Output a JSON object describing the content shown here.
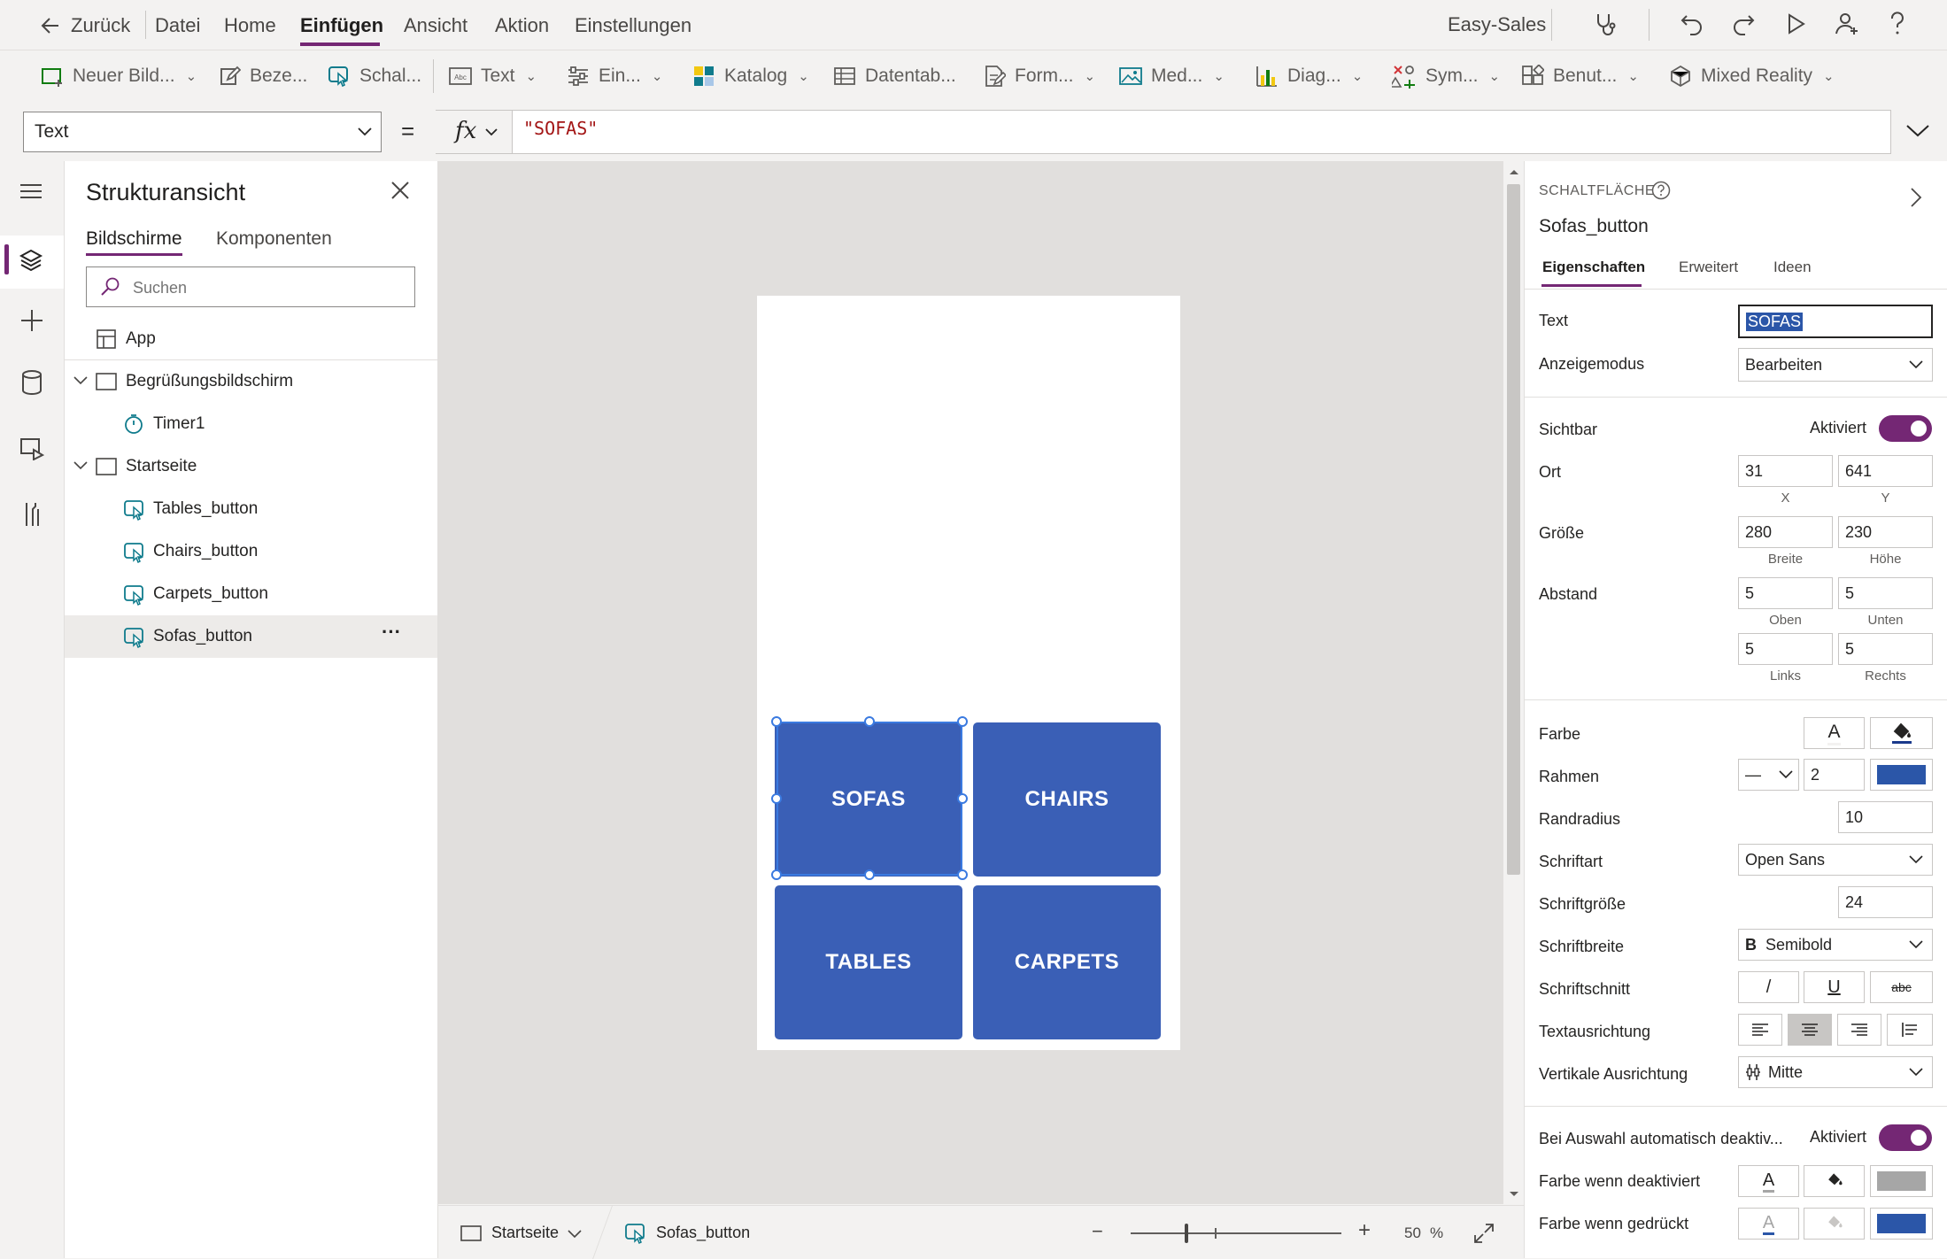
{
  "menubar": {
    "back_label": "Zurück",
    "items": [
      "Datei",
      "Home",
      "Einfügen",
      "Ansicht",
      "Aktion",
      "Einstellungen"
    ],
    "active_item": "Einfügen",
    "app_name": "Easy-Sales"
  },
  "ribbon": {
    "items": [
      {
        "label": "Neuer Bild...",
        "icon": "new-screen-icon"
      },
      {
        "label": "Beze...",
        "icon": "label-icon"
      },
      {
        "label": "Schal...",
        "icon": "button-icon"
      },
      {
        "label": "Text",
        "icon": "text-input-icon"
      },
      {
        "label": "Ein...",
        "icon": "sliders-icon"
      },
      {
        "label": "Katalog",
        "icon": "gallery-icon"
      },
      {
        "label": "Datentab...",
        "icon": "data-table-icon"
      },
      {
        "label": "Form...",
        "icon": "form-icon"
      },
      {
        "label": "Med...",
        "icon": "media-icon"
      },
      {
        "label": "Diag...",
        "icon": "chart-icon"
      },
      {
        "label": "Sym...",
        "icon": "symbols-icon"
      },
      {
        "label": "Benut...",
        "icon": "custom-icon"
      },
      {
        "label": "Mixed Reality",
        "icon": "mixed-reality-icon"
      }
    ]
  },
  "formula": {
    "property": "Text",
    "equals": "=",
    "fx": "fx",
    "value": "\"SOFAS\""
  },
  "tree": {
    "title": "Strukturansicht",
    "tabs": [
      "Bildschirme",
      "Komponenten"
    ],
    "active_tab": "Bildschirme",
    "search_placeholder": "Suchen",
    "app_label": "App",
    "screens": [
      {
        "name": "Begrüßungsbildschirm",
        "children": [
          "Timer1"
        ]
      },
      {
        "name": "Startseite",
        "children": [
          "Tables_button",
          "Chairs_button",
          "Carpets_button",
          "Sofas_button"
        ]
      }
    ],
    "selected": "Sofas_button",
    "more": "···"
  },
  "canvas": {
    "buttons": [
      "SOFAS",
      "CHAIRS",
      "TABLES",
      "CARPETS"
    ],
    "button_color": "#3a5fb6",
    "selected_button": "SOFAS"
  },
  "statusbar": {
    "screen": "Startseite",
    "control": "Sofas_button",
    "zoom_minus": "−",
    "zoom_plus": "+",
    "zoom_value": "50",
    "zoom_unit": "%"
  },
  "props": {
    "type_label": "SCHALTFLÄCHE",
    "control_name": "Sofas_button",
    "tabs": [
      "Eigenschaften",
      "Erweitert",
      "Ideen"
    ],
    "active_tab": "Eigenschaften",
    "text": {
      "label": "Text",
      "value": "SOFAS"
    },
    "display_mode": {
      "label": "Anzeigemodus",
      "value": "Bearbeiten"
    },
    "visible": {
      "label": "Sichtbar",
      "value": "Aktiviert"
    },
    "position": {
      "label": "Ort",
      "x": "31",
      "y": "641",
      "x_label": "X",
      "y_label": "Y"
    },
    "size": {
      "label": "Größe",
      "width": "280",
      "height": "230",
      "width_label": "Breite",
      "height_label": "Höhe"
    },
    "padding": {
      "label": "Abstand",
      "top": "5",
      "bottom": "5",
      "left": "5",
      "right": "5",
      "top_label": "Oben",
      "bottom_label": "Unten",
      "left_label": "Links",
      "right_label": "Rechts"
    },
    "color": {
      "label": "Farbe",
      "text_glyph": "A",
      "accent": "#1b3a8c"
    },
    "border": {
      "label": "Rahmen",
      "style_glyph": "—",
      "value": "2",
      "color": "#2b56a8"
    },
    "radius": {
      "label": "Randradius",
      "value": "10"
    },
    "font": {
      "label": "Schriftart",
      "value": "Open Sans"
    },
    "font_size": {
      "label": "Schriftgröße",
      "value": "24"
    },
    "font_weight": {
      "label": "Schriftbreite",
      "glyph": "B",
      "value": "Semibold"
    },
    "font_style": {
      "label": "Schriftschnitt",
      "italic": "/",
      "underline": "U",
      "strike": "abc"
    },
    "text_align": {
      "label": "Textausrichtung"
    },
    "vertical_align": {
      "label": "Vertikale Ausrichtung",
      "value": "Mitte"
    },
    "auto_disable": {
      "label": "Bei Auswahl automatisch deaktiv...",
      "value": "Aktiviert"
    },
    "disabled_color": {
      "label": "Farbe wenn deaktiviert",
      "text_glyph": "A",
      "fill": "#a6a6a6"
    },
    "pressed_color": {
      "label": "Farbe wenn gedrückt",
      "text_glyph": "A",
      "fill": "#2b56a8",
      "text_underline": "#2b56a8"
    }
  }
}
